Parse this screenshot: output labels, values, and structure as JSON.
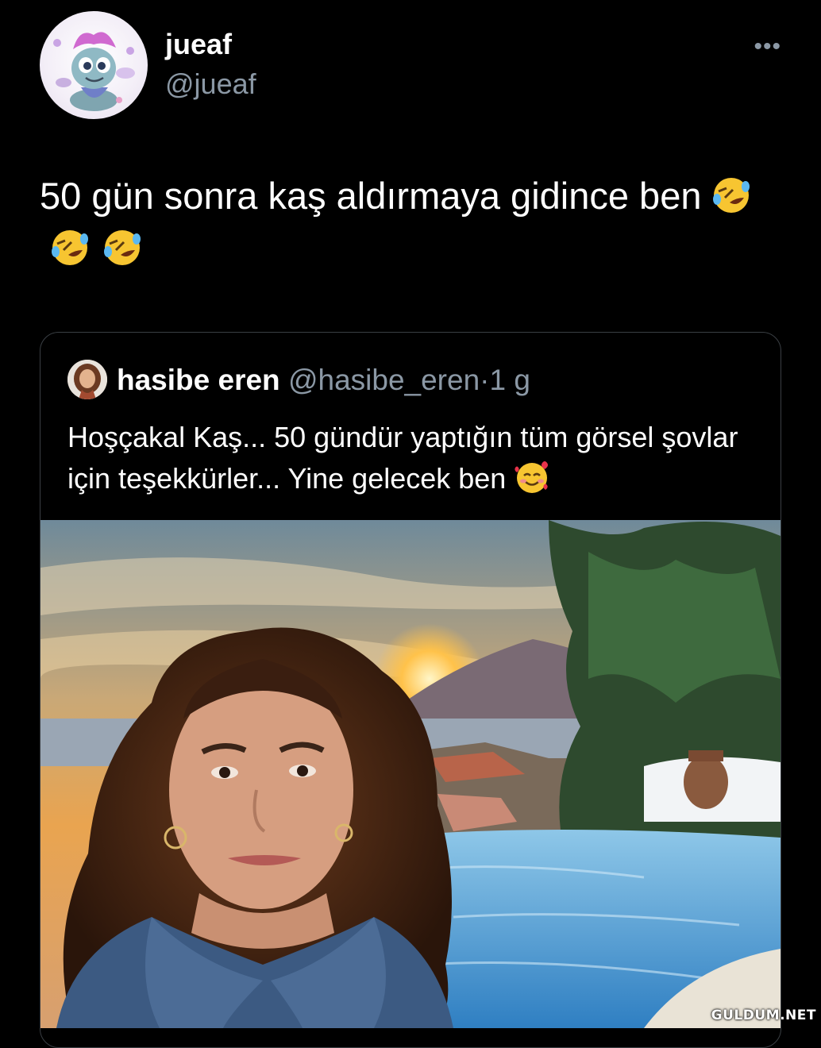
{
  "tweet": {
    "display_name": "jueaf",
    "handle": "@jueaf",
    "more_label": "•••",
    "text": "50 gün sonra kaş aldırmaya gidince ben",
    "emojis": [
      "rolling-on-floor-laughing",
      "rolling-on-floor-laughing",
      "rolling-on-floor-laughing"
    ]
  },
  "quoted_tweet": {
    "display_name": "hasibe eren",
    "handle": "@hasibe_eren",
    "separator": "·",
    "time": "1 g",
    "text": "Hoşçakal Kaş... 50 gündür yaptığın tüm görsel şovlar için teşekkürler... Yine gelecek ben",
    "emoji": "smiling-face-with-hearts",
    "image": "selfie at sunset by infinity pool"
  },
  "watermark": "GULDUM.NET",
  "colors": {
    "background": "#000000",
    "text": "#ffffff",
    "secondary": "#8b98a5",
    "border": "#3a3f44"
  }
}
